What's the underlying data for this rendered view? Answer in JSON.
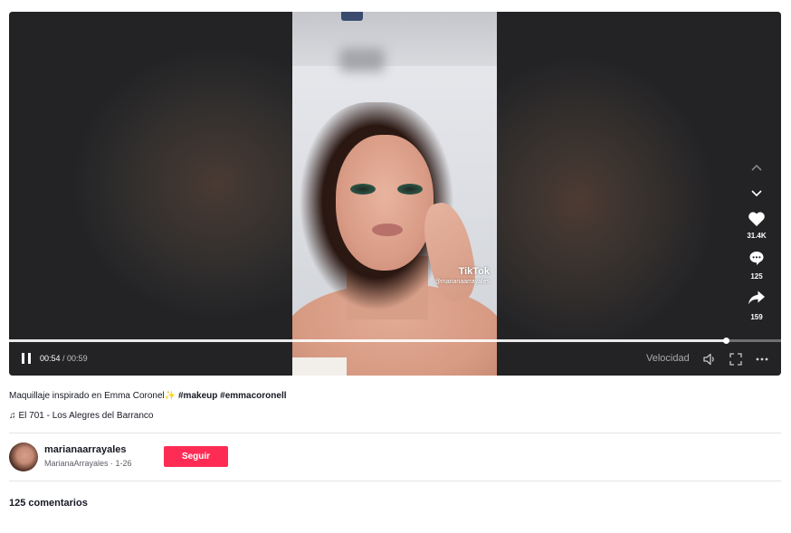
{
  "video": {
    "watermark_logo": "TikTok",
    "watermark_user": "@marianaarrayales",
    "time_current": "00:54",
    "time_separator": " / ",
    "time_total": "00:59",
    "speed_label": "Velocidad",
    "progress_fraction": 0.928
  },
  "side_actions": {
    "prev_icon": "chevron-up-icon",
    "next_icon": "chevron-down-icon",
    "likes": "31.4K",
    "comments": "125",
    "shares": "159"
  },
  "post": {
    "caption_text": "Maquillaje inspirado en Emma Coronel",
    "caption_spark": "✨",
    "hashtags": [
      "#makeup",
      "#emmacoronell"
    ],
    "music_note": "♫",
    "music": "El 701 - Los Alegres del Barranco"
  },
  "author": {
    "username": "marianaarrayales",
    "meta": "MarianaArrayales · 1-26",
    "follow_label": "Seguir"
  },
  "comments_header": "125 comentarios",
  "colors": {
    "follow": "#fe2c55",
    "player_bg": "#26262a"
  }
}
